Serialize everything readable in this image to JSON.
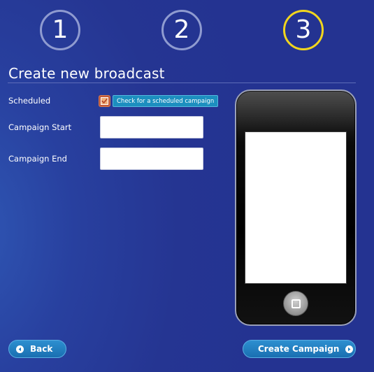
{
  "steps": [
    {
      "label": "1",
      "active": false
    },
    {
      "label": "2",
      "active": false
    },
    {
      "label": "3",
      "active": true
    }
  ],
  "form": {
    "title": "Create new broadcast",
    "scheduled_label": "Scheduled",
    "scheduled_checked": true,
    "scheduled_tooltip": "Check for a scheduled campaign",
    "campaign_start_label": "Campaign Start",
    "campaign_start_value": "",
    "campaign_end_label": "Campaign End",
    "campaign_end_value": ""
  },
  "buttons": {
    "back_label": "Back",
    "create_label": "Create Campaign"
  },
  "icons": {
    "back": "arrow-left-circle-icon",
    "create": "arrow-right-circle-icon",
    "check": "checkmark-icon",
    "home": "home-button-icon"
  },
  "colors": {
    "background": "#253592",
    "active_step": "#f1d51e",
    "inactive_step": "#8f9bd0",
    "button": "#1f7bbf",
    "tooltip": "#1c8fbf",
    "checkbox": "#c05a3a"
  }
}
